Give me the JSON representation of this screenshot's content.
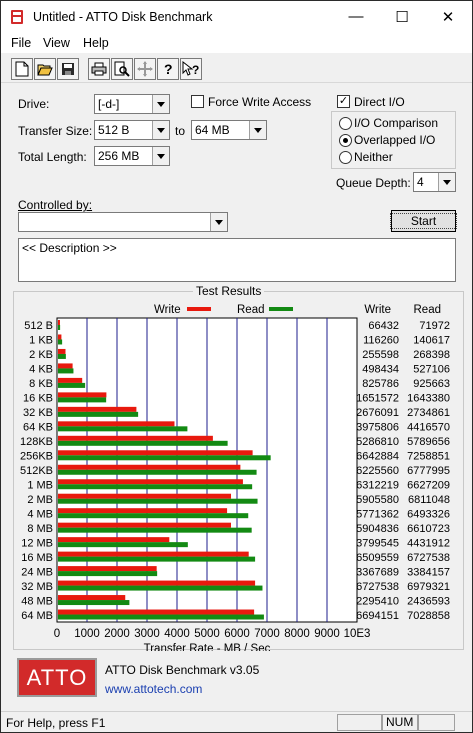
{
  "window": {
    "title": "Untitled - ATTO Disk Benchmark",
    "minimize": "—",
    "maximize": "☐",
    "close": "✕"
  },
  "menu": [
    "File",
    "View",
    "Help"
  ],
  "toolbar": [
    "new-icon",
    "open-icon",
    "save-icon",
    "print-icon",
    "print-preview-icon",
    "move-icon",
    "about-icon",
    "context-help-icon"
  ],
  "form": {
    "drive_label": "Drive:",
    "drive_value": "[-d-]",
    "force_write_label": "Force Write Access",
    "force_write_checked": false,
    "direct_io_label": "Direct I/O",
    "direct_io_checked": true,
    "transfer_size_label": "Transfer Size:",
    "transfer_from": "512 B",
    "to_label": "to",
    "transfer_to": "64 MB",
    "total_length_label": "Total Length:",
    "total_length": "256 MB",
    "io_options": [
      "I/O Comparison",
      "Overlapped I/O",
      "Neither"
    ],
    "io_selected": 1,
    "queue_depth_label": "Queue Depth:",
    "queue_depth": "4",
    "controlled_by_label": "Controlled by:",
    "controlled_by_value": "",
    "start_label": "Start",
    "description": "<< Description >>"
  },
  "results": {
    "title": "Test Results",
    "write_legend": "Write",
    "read_legend": "Read",
    "write_header": "Write",
    "read_header": "Read",
    "write_color": "#e8190e",
    "read_color": "#138a13"
  },
  "chart_data": {
    "type": "bar",
    "orientation": "horizontal",
    "categories": [
      "512 B",
      "1 KB",
      "2 KB",
      "4 KB",
      "8 KB",
      "16 KB",
      "32 KB",
      "64 KB",
      "128KB",
      "256KB",
      "512KB",
      "1 MB",
      "2 MB",
      "4 MB",
      "8 MB",
      "12 MB",
      "16 MB",
      "24 MB",
      "32 MB",
      "48 MB",
      "64 MB"
    ],
    "series": [
      {
        "name": "Write",
        "values": [
          66432,
          116260,
          255598,
          498434,
          825786,
          1651572,
          2676091,
          3975806,
          5286810,
          6642884,
          6225560,
          6312219,
          5905580,
          5771362,
          5904836,
          3799545,
          6509559,
          3367689,
          6727538,
          2295410,
          6694151
        ]
      },
      {
        "name": "Read",
        "values": [
          71972,
          140617,
          268398,
          527106,
          925663,
          1643380,
          2734861,
          4416570,
          5789656,
          7258851,
          6777995,
          6627209,
          6811048,
          6493326,
          6610723,
          4431912,
          6727538,
          3384157,
          6979321,
          2436593,
          7028858
        ]
      }
    ],
    "xlabel": "Transfer Rate - MB / Sec",
    "xticks": [
      "0",
      "1000",
      "2000",
      "3000",
      "4000",
      "5000",
      "6000",
      "7000",
      "8000",
      "9000",
      "10E3"
    ],
    "xlim": [
      0,
      10000
    ],
    "grid": true,
    "legend": "top"
  },
  "footer": {
    "logo_text": "ATTO",
    "product": "ATTO Disk Benchmark v3.05",
    "url": "www.attotech.com"
  },
  "status": {
    "message": "For Help, press F1",
    "num": "NUM"
  }
}
